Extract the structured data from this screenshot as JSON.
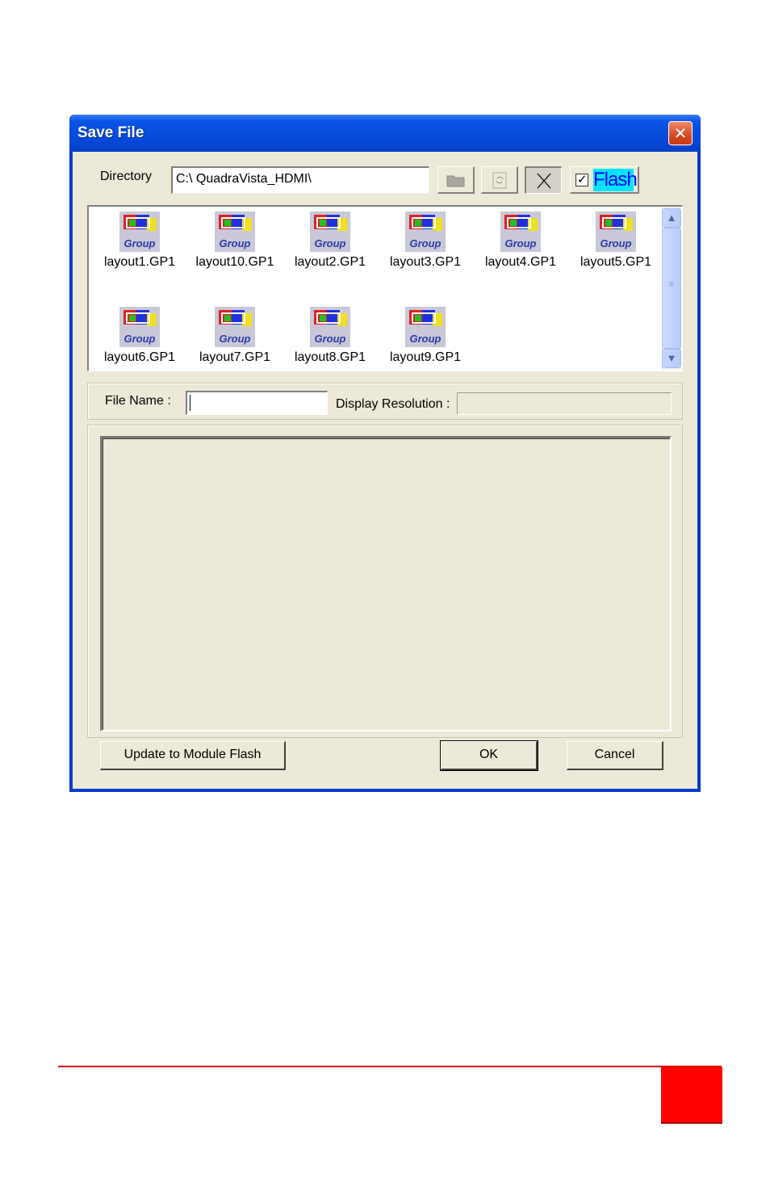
{
  "window": {
    "title": "Save File"
  },
  "directory": {
    "label": "Directory",
    "path": "C:\\ QuadraVista_HDMI\\"
  },
  "toolbar": {
    "flash_label": "Flash",
    "flash_checked": true
  },
  "files": [
    {
      "name": "layout1.GP1",
      "icon": "group-layout-icon"
    },
    {
      "name": "layout10.GP1",
      "icon": "group-layout-icon"
    },
    {
      "name": "layout2.GP1",
      "icon": "group-layout-icon"
    },
    {
      "name": "layout3.GP1",
      "icon": "group-layout-icon"
    },
    {
      "name": "layout4.GP1",
      "icon": "group-layout-icon"
    },
    {
      "name": "layout5.GP1",
      "icon": "group-layout-icon"
    },
    {
      "name": "layout6.GP1",
      "icon": "group-layout-icon"
    },
    {
      "name": "layout7.GP1",
      "icon": "group-layout-icon"
    },
    {
      "name": "layout8.GP1",
      "icon": "group-layout-icon"
    },
    {
      "name": "layout9.GP1",
      "icon": "group-layout-icon"
    }
  ],
  "file_icon_text": "Group",
  "filename": {
    "label": "File Name :",
    "value": ""
  },
  "resolution": {
    "label": "Display Resolution :",
    "value": ""
  },
  "buttons": {
    "update": "Update to Module Flash",
    "ok": "OK",
    "cancel": "Cancel"
  },
  "colors": {
    "titlebar": "#0a54e6",
    "close": "#d84a1e",
    "dialog_face": "#ece9d8",
    "footer_rule": "#e00000",
    "footer_box": "#ff0000"
  }
}
